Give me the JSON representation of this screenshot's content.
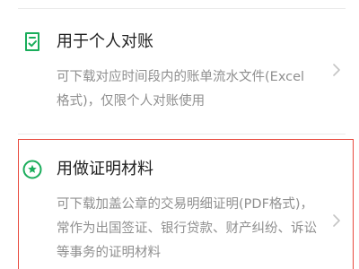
{
  "accent_color": "#1aad5b",
  "highlight_color": "#e84a3e",
  "options": [
    {
      "icon": "document-check-icon",
      "title": "用于个人对账",
      "description": "可下载对应时间段内的账单流水文件(Excel格式)，仅限个人对账使用",
      "chevron": "chevron-right-icon"
    },
    {
      "icon": "star-badge-icon",
      "title": "用做证明材料",
      "description": "可下载加盖公章的交易明细证明(PDF格式)，常作为出国签证、银行贷款、财产纠纷、诉讼等事务的证明材料",
      "chevron": "chevron-right-icon"
    }
  ]
}
